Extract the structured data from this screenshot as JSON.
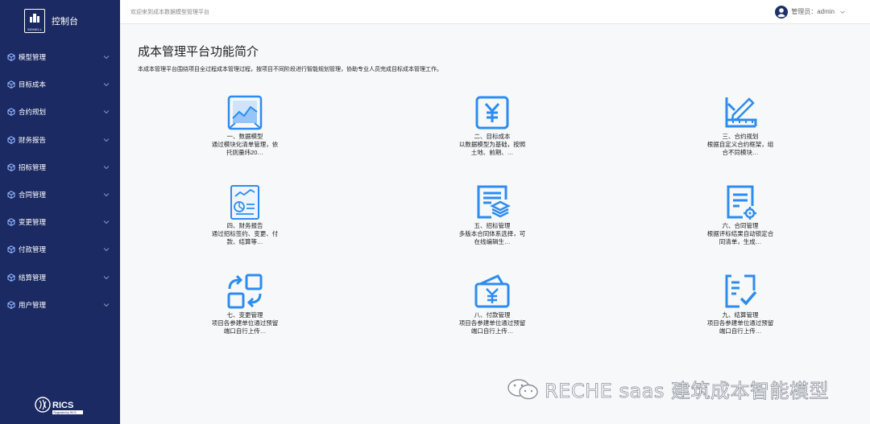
{
  "brand": {
    "logo_text": "SIDNELL",
    "title": "控制台"
  },
  "sidebar": {
    "items": [
      {
        "label": "模型管理"
      },
      {
        "label": "目标成本"
      },
      {
        "label": "合约规划"
      },
      {
        "label": "财务报告"
      },
      {
        "label": "招标管理"
      },
      {
        "label": "合同管理"
      },
      {
        "label": "变更管理"
      },
      {
        "label": "付款管理"
      },
      {
        "label": "结算管理"
      },
      {
        "label": "用户管理"
      }
    ],
    "footer_logo": "RICS",
    "footer_tag": "Regulated by RICS"
  },
  "header": {
    "welcome": "欢迎来到成本数据模型管理平台",
    "user_label": "管理员：admin"
  },
  "main": {
    "title": "成本管理平台功能简介",
    "description": "本成本管理平台围绕项目全过程成本管理过程，按项目不同阶段进行智能规划管理，协助专业人员完成目标成本管理工作。",
    "cards": [
      {
        "title": "一、数据模型",
        "desc": "通过模块化清单管理，依托则量纬20…",
        "icon": "chart-icon"
      },
      {
        "title": "二、目标成本",
        "desc": "以数据模型为基础，按照土地、前期、…",
        "icon": "yuan-icon"
      },
      {
        "title": "三、合约规划",
        "desc": "根据自定义合约框架，组合不同模块…",
        "icon": "ruler-pen-icon"
      },
      {
        "title": "四、财务报告",
        "desc": "通过招标签约、变更、付款、结算等…",
        "icon": "report-icon"
      },
      {
        "title": "五、招标管理",
        "desc": "多版本合同体系选择，可在线编辑生…",
        "icon": "doc-layers-icon"
      },
      {
        "title": "六、合同管理",
        "desc": "根据评标结果自动锁定合同清单，生成…",
        "icon": "doc-gear-icon"
      },
      {
        "title": "七、变更管理",
        "desc": "项目各参建单位通过预留端口自行上传…",
        "icon": "swap-icon"
      },
      {
        "title": "八、付款管理",
        "desc": "项目各参建单位通过预留端口自行上传…",
        "icon": "wallet-icon"
      },
      {
        "title": "九、结算管理",
        "desc": "项目各参建单位通过预留端口自行上传…",
        "icon": "checklist-icon"
      }
    ]
  },
  "watermark": {
    "text": "RECHE saas 建筑成本智能模型"
  },
  "colors": {
    "sidebar": "#1c2a63",
    "accent": "#2d8cf0",
    "header_bg": "#ffffff",
    "page_bg": "#f7f8fa"
  }
}
